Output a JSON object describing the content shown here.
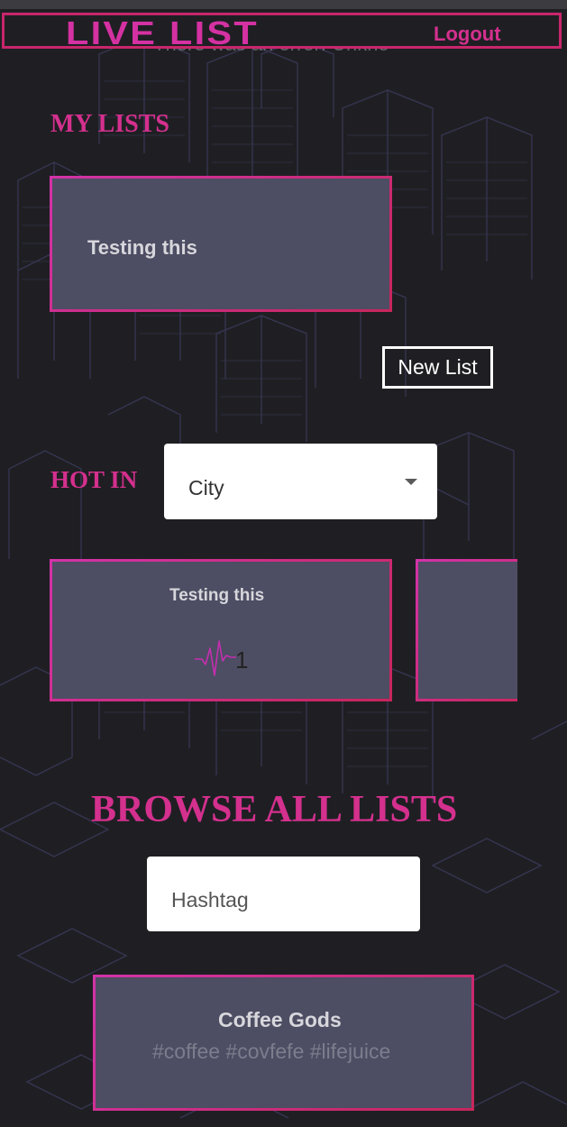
{
  "header": {
    "brand": "LIVE LIST",
    "logout_label": "Logout",
    "ghost_text": "There was an error: Unkno"
  },
  "my_lists": {
    "heading": "MY LISTS",
    "items": [
      {
        "title": "Testing this"
      }
    ],
    "new_list_label": "New List"
  },
  "hot_in": {
    "heading": "HOT IN",
    "select_value": "City",
    "cards": [
      {
        "title": "Testing this",
        "count": "1"
      },
      {
        "title": "",
        "count": ""
      }
    ]
  },
  "browse": {
    "heading": "BROWSE ALL LISTS",
    "search_placeholder": "Hashtag",
    "results": [
      {
        "title": "Coffee Gods",
        "tags": "#coffee #covfefe #lifejuice"
      }
    ]
  },
  "colors": {
    "background": "#1f1f23",
    "accent_pink": "#d4308e",
    "card_fill": "#4d4d63",
    "card_border": "#c1257c",
    "city_lines": "#3a3a5a"
  },
  "icons": {
    "pulse": "heartbeat-pulse-icon",
    "caret": "caret-down-icon"
  }
}
